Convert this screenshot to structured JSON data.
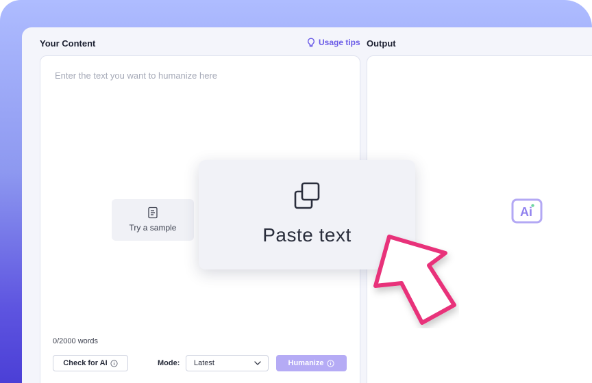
{
  "left_panel": {
    "title": "Your Content",
    "usage_tips": "Usage tips",
    "placeholder": "Enter the text you want to humanize here",
    "try_sample": "Try a sample",
    "word_count": "0/2000 words",
    "check_ai": "Check for AI",
    "mode_label": "Mode:",
    "mode_value": "Latest",
    "humanize": "Humanize"
  },
  "right_panel": {
    "title": "Output",
    "logo_text": "Ai"
  },
  "paste_overlay": {
    "label": "Paste text"
  },
  "colors": {
    "accent": "#6b5ce7",
    "humanize_button": "#b5abf5",
    "cursor_pink": "#e8317a"
  }
}
